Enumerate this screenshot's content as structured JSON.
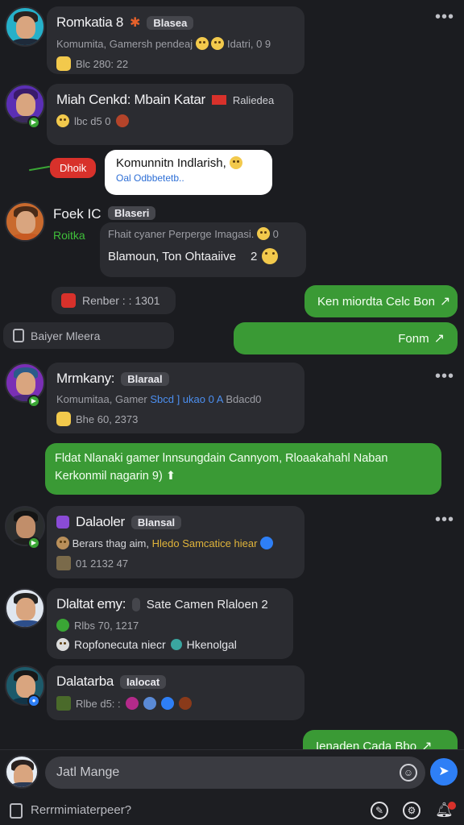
{
  "messages": [
    {
      "name": "Romkatia 8",
      "tag": "Blasea",
      "subtitle": "Komumita, Gamersh pendeaj",
      "subtitle_extra": "Idatri, 0 9",
      "meta": "Blc 280: 22",
      "avatar_color": "#26b0c9"
    },
    {
      "name": "Miah Cenkd: Mbain Katar",
      "tag": "Raliedea",
      "meta": "lbc d5 0"
    },
    {
      "name": "Foek IC",
      "tag": "Blaseri",
      "side_label": "Roitka",
      "subtitle": "Fhait cyaner Perperge Imagasi.",
      "subtitle_extra": "0",
      "highlight": "Blamoun, Ton Ohtaaiive",
      "highlight_num": "2"
    },
    {
      "name": "Mrmkany:",
      "tag": "Blaraal",
      "subtitle": "Komumitaa, Gamer",
      "subtitle_blue": "Sbcd ] ukao 0 A",
      "subtitle_extra": "Bdacd0",
      "meta": "Bhe 60, 2373"
    },
    {
      "name": "Dalaoler",
      "tag": "Blansal",
      "subtitle": "Berars thag aim,",
      "subtitle_yellow": "Hledo Samcatice hiear",
      "meta": "01 2132 47"
    },
    {
      "name": "Dlaltat emy:",
      "title_extra": "Sate Camen Rlaloen 2",
      "meta": "Rlbs 70, 1217",
      "meta2": "Ropfonecuta niecr",
      "meta2_extra": "Hkenolgal"
    },
    {
      "name": "Dalatarba",
      "tag": "Ialocat",
      "meta": "Rlbe d5: :"
    }
  ],
  "white_bubble": {
    "line1": "Komunnitn Indlarish,",
    "line2": "Oal Odbbetetb.."
  },
  "red_pill": "Dhoik",
  "dark_pill_1": "Renber : : 1301",
  "dark_pill_2": "Baiyer Mleera",
  "green_1": "Ken miordta Celc Bon",
  "green_2": "Fonm",
  "green_long": {
    "line1": "Fldat Nlanaki gamer lnnsungdain Cannyom, Rloaakahahl Naban",
    "line2": "Kerkonmil nagarin 9)"
  },
  "green_peek": "Ienaden Cada Bbo",
  "composer": {
    "placeholder": "Jatl Mange"
  },
  "bottom_bar": {
    "label": "Rerrmimiaterpeer?"
  },
  "colors": {
    "background": "#1b1c20",
    "bubble": "#2b2c31",
    "green": "#3a9a35",
    "send": "#2e7ff6"
  }
}
